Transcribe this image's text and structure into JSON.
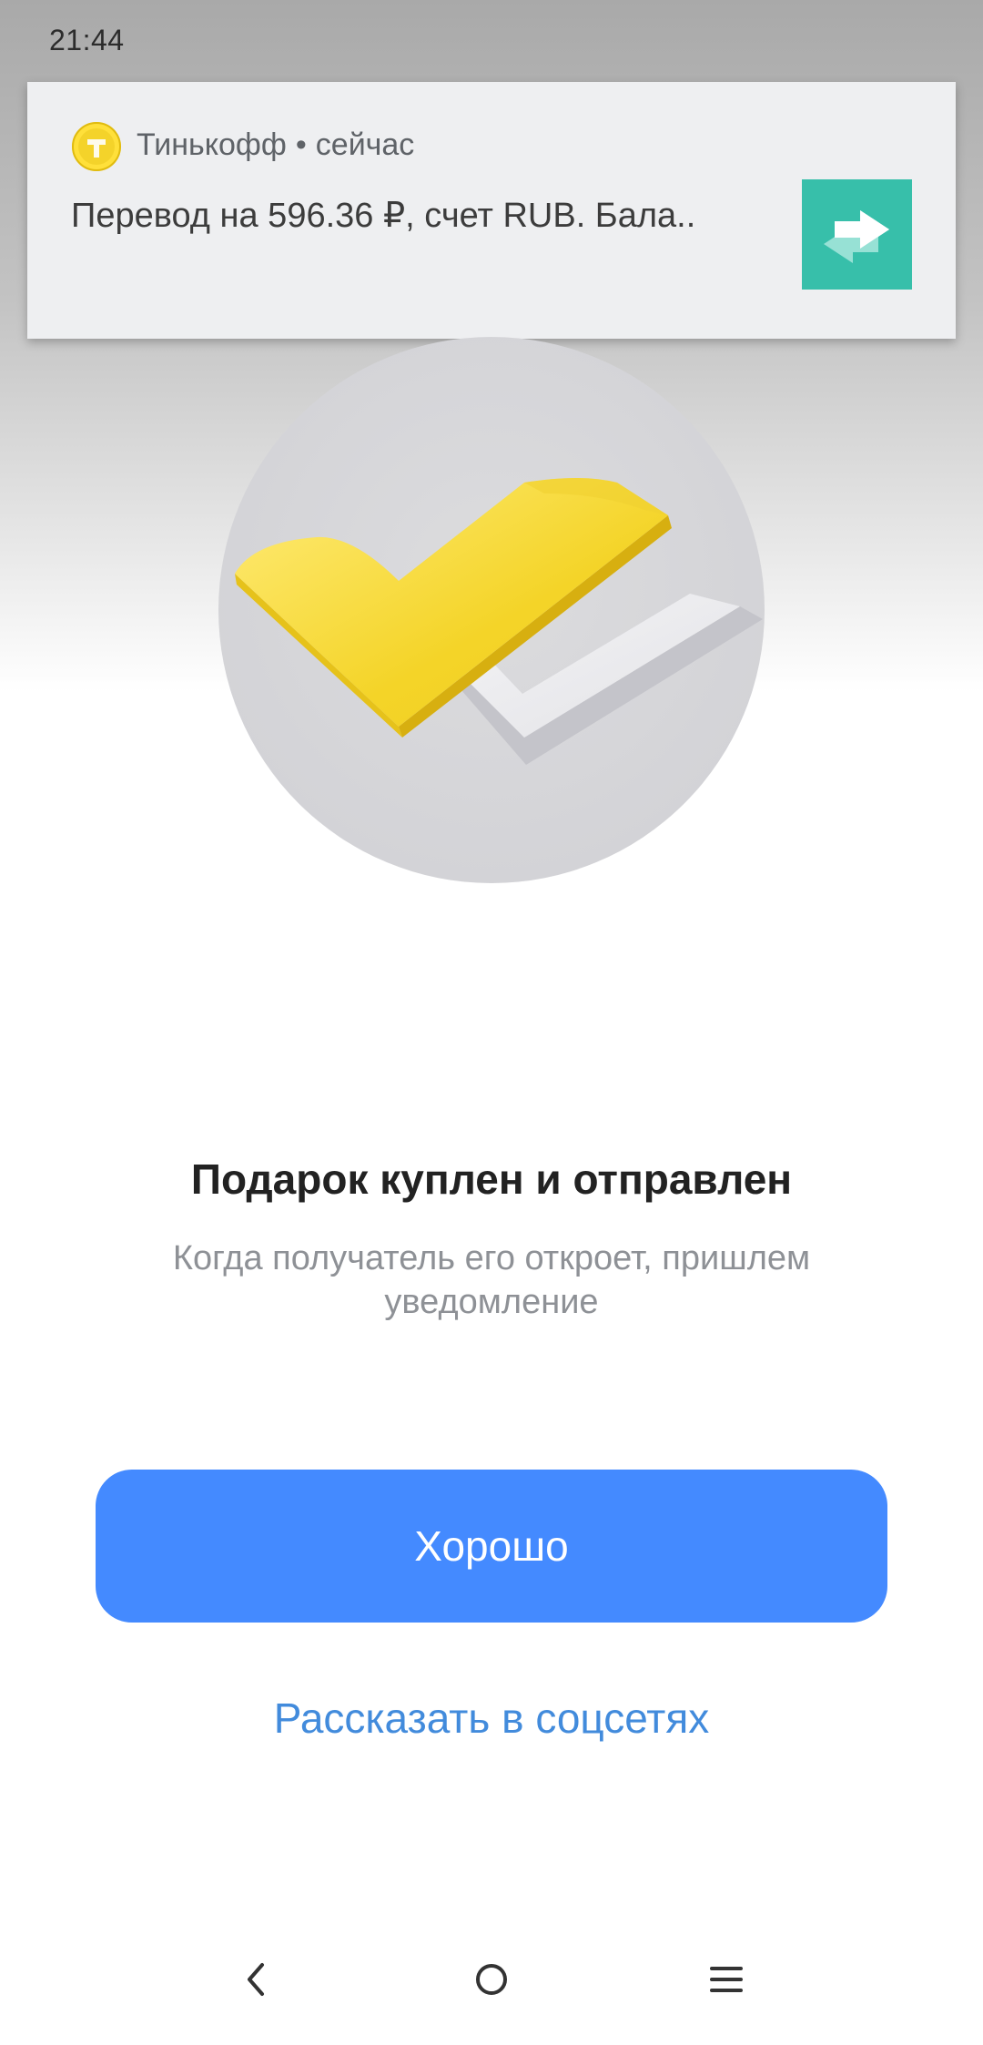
{
  "status_bar": {
    "time": "21:44"
  },
  "notification": {
    "app_name": "Тинькофф",
    "separator": "•",
    "time_label": "сейчас",
    "text": "Перевод на 596.36 ₽, счет RUB. Бала..",
    "app_icon": "tinkoff-logo-icon",
    "thumbnail_icon": "transfer-arrows-icon",
    "thumbnail_color": "#37bfaa"
  },
  "main": {
    "illustration": "double-checkmark-icon",
    "title": "Подарок куплен и отправлен",
    "subtitle": "Когда получатель его откроет, пришлем уведомление"
  },
  "actions": {
    "ok_label": "Хорошо",
    "share_label": "Рассказать в соцсетях"
  },
  "nav_bar": {
    "back": "back-icon",
    "home": "home-icon",
    "menu": "menu-icon"
  },
  "colors": {
    "accent": "#448aff",
    "link": "#428bdc",
    "brand_yellow": "#f5d82a"
  }
}
